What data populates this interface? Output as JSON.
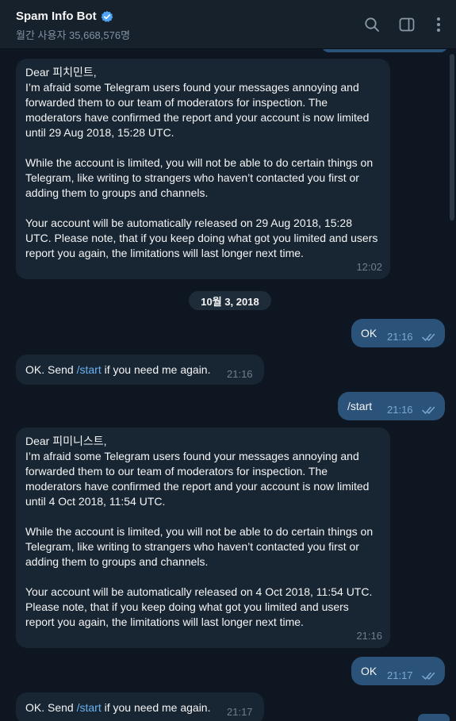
{
  "header": {
    "title": "Spam Info Bot",
    "subtitle": "월간 사용자 35,668,576명",
    "icons": [
      "verified-badge-icon",
      "search-icon",
      "sidebar-toggle-icon",
      "more-vertical-icon"
    ]
  },
  "colors": {
    "background": "#0e1621",
    "header": "#17212b",
    "incoming_bubble": "#182533",
    "outgoing_bubble": "#2b5278",
    "link": "#6ab2f2",
    "verified": "#4ea4f6"
  },
  "messages": [
    {
      "direction": "incoming",
      "greeting": "Dear 피치민트,",
      "p1": "I’m afraid some Telegram users found your messages annoying and forwarded them to our team of moderators for inspection. The moderators have confirmed the report and your account is now limited until 29 Aug 2018, 15:28 UTC.",
      "p2": "While the account is limited, you will not be able to do certain things on Telegram, like writing to strangers who haven’t contacted you first or adding them to groups and channels.",
      "p3": "Your account will be automatically released on 29 Aug 2018, 15:28 UTC. Please note, that if you keep doing what got you limited and users report you again, the limitations will last longer next time.",
      "time": "12:02"
    },
    {
      "direction": "date",
      "label": "10월 3, 2018"
    },
    {
      "direction": "outgoing",
      "text": "OK",
      "time": "21:16"
    },
    {
      "direction": "incoming",
      "pre": "OK. Send ",
      "command": "/start",
      "post": " if you need me again.",
      "time": "21:16"
    },
    {
      "direction": "outgoing",
      "text": "/start",
      "time": "21:16"
    },
    {
      "direction": "incoming",
      "greeting": "Dear 피미니스트,",
      "p1": "I’m afraid some Telegram users found your messages annoying and forwarded them to our team of moderators for inspection. The moderators have confirmed the report and your account is now limited until 4 Oct 2018, 11:54 UTC.",
      "p2": "While the account is limited, you will not be able to do certain things on Telegram, like writing to strangers who haven’t contacted you first or adding them to groups and channels.",
      "p3": "Your account will be automatically released on 4 Oct 2018, 11:54 UTC. Please note, that if you keep doing what got you limited and users report you again, the limitations will last longer next time.",
      "time": "21:16"
    },
    {
      "direction": "outgoing",
      "text": "OK",
      "time": "21:17"
    },
    {
      "direction": "incoming",
      "pre": "OK. Send ",
      "command": "/start",
      "post": " if you need me again.",
      "time": "21:17"
    }
  ]
}
